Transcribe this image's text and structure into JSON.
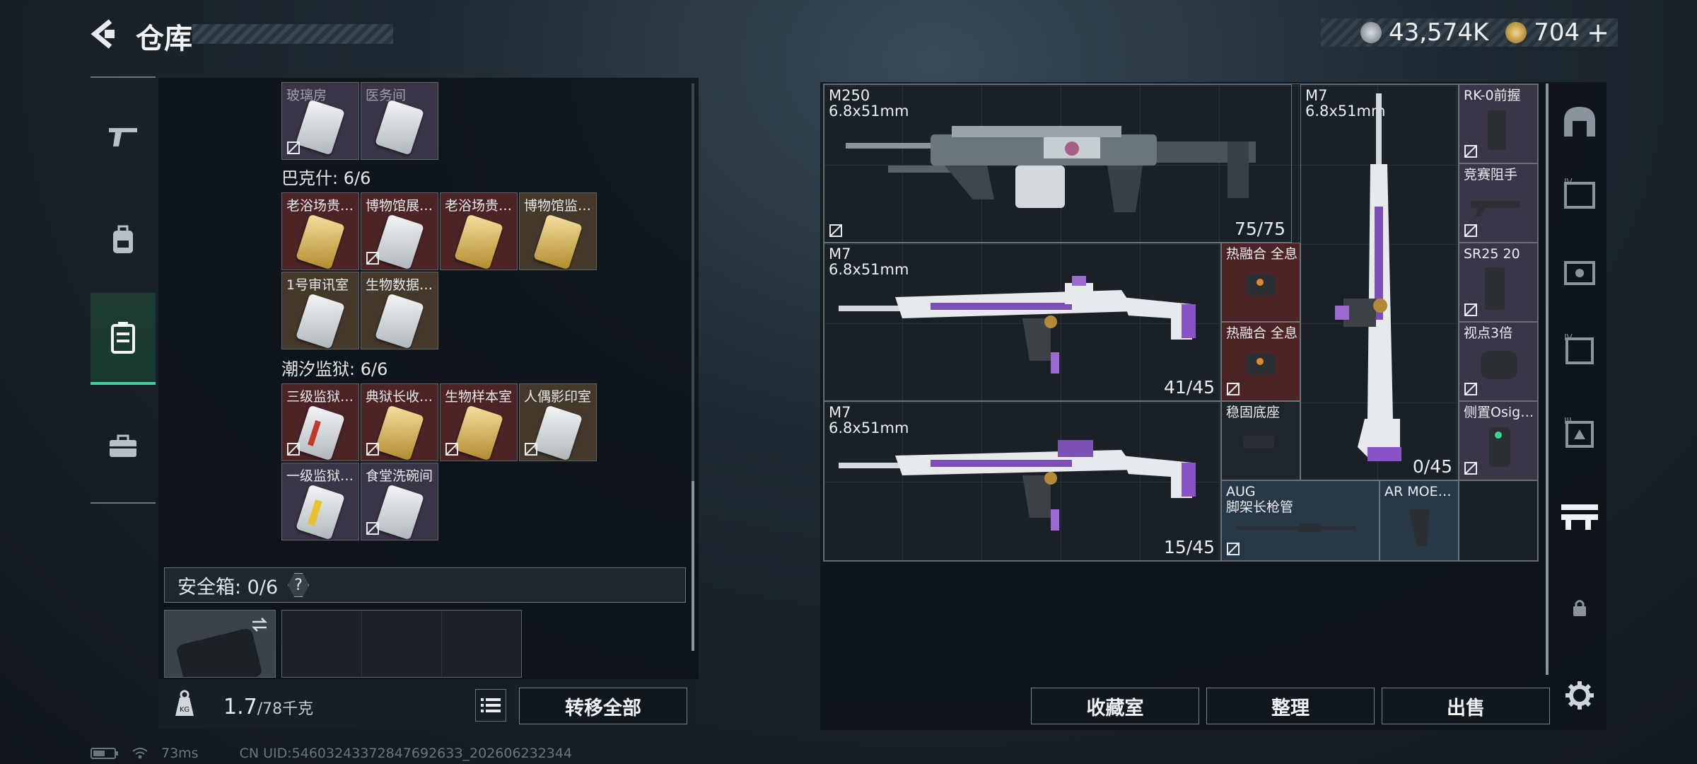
{
  "header": {
    "title": "仓库"
  },
  "currency": {
    "silver": "43,574K",
    "gold": "704",
    "add": "+"
  },
  "nav_left": [
    "weapon-icon",
    "backpack-icon",
    "storage-icon",
    "toolbox-icon"
  ],
  "keys": {
    "top_row": [
      "玻璃房",
      "医务间"
    ],
    "section1": {
      "title": "巴克什: 6/6",
      "items": [
        "老浴场贵…",
        "博物馆展…",
        "老浴场贵…",
        "博物馆监…",
        "1号审讯室",
        "生物数据…"
      ]
    },
    "section2": {
      "title": "潮汐监狱: 6/6",
      "items": [
        "三级监狱…",
        "典狱长收…",
        "生物样本室",
        "人偶影印室",
        "一级监狱…",
        "食堂洗碗间"
      ]
    }
  },
  "safe": {
    "label": "安全箱: 0/6",
    "help": "?"
  },
  "weight": {
    "current": "1.7",
    "max": "/78千克"
  },
  "buttons": {
    "transfer_all": "转移全部",
    "collection": "收藏室",
    "organize": "整理",
    "sell": "出售"
  },
  "status": {
    "ping": "73ms",
    "uid": "CN UID:5460324337284769263З_202606232344"
  },
  "weapons": [
    {
      "name": "M250",
      "caliber": "6.8x51mm",
      "ammo": "75/75"
    },
    {
      "name": "M7",
      "caliber": "6.8x51mm",
      "ammo": "41/45"
    },
    {
      "name": "M7",
      "caliber": "6.8x51mm",
      "ammo": "15/45"
    },
    {
      "name": "M7",
      "caliber": "6.8x51mm",
      "ammo": "0/45"
    }
  ],
  "attachments": [
    "热融合 全息",
    "热融合 全息",
    "稳固底座",
    "RK-0前握",
    "竞赛阻手",
    "SR25 20",
    "视点3倍",
    "侧置Osig…",
    "AR MOE…"
  ],
  "aug": {
    "line1": "AUG",
    "line2": "脚架长枪管"
  },
  "colors": {
    "accent_green": "#3fd39a",
    "slot_red": "#4d2426",
    "slot_brown": "#45392c",
    "slot_purple": "#3a3547",
    "slot_blue": "#283847"
  }
}
